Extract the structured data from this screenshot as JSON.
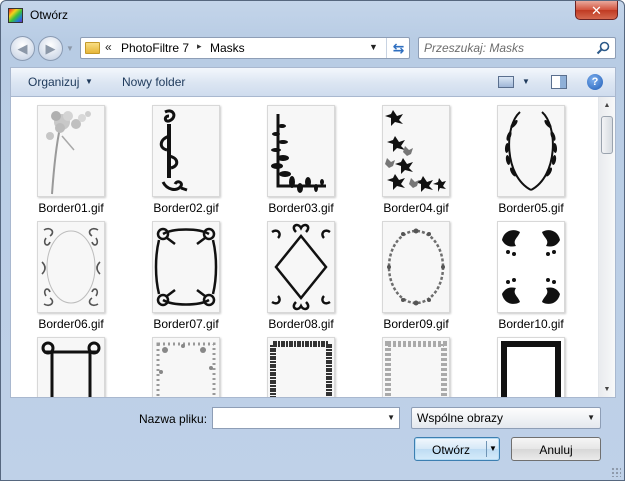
{
  "window": {
    "title": "Otwórz"
  },
  "nav": {
    "crumb_overflow": "«",
    "path": [
      "PhotoFiltre 7",
      "Masks"
    ],
    "path_separator": "▸"
  },
  "search": {
    "placeholder": "Przeszukaj: Masks"
  },
  "toolbar": {
    "organize_label": "Organizuj",
    "new_folder_label": "Nowy folder"
  },
  "files": [
    {
      "name": "Border01.gif",
      "icon": "mask-flower"
    },
    {
      "name": "Border02.gif",
      "icon": "mask-scroll-side"
    },
    {
      "name": "Border03.gif",
      "icon": "mask-leaf-corner"
    },
    {
      "name": "Border04.gif",
      "icon": "mask-maple-corner"
    },
    {
      "name": "Border05.gif",
      "icon": "mask-laurel"
    },
    {
      "name": "Border06.gif",
      "icon": "mask-ornate-oval"
    },
    {
      "name": "Border07.gif",
      "icon": "mask-knot-frame"
    },
    {
      "name": "Border08.gif",
      "icon": "mask-diamond-frame"
    },
    {
      "name": "Border09.gif",
      "icon": "mask-vine-oval"
    },
    {
      "name": "Border10.gif",
      "icon": "mask-leaf-corners"
    },
    {
      "name": "",
      "icon": "mask-post-curl"
    },
    {
      "name": "",
      "icon": "mask-floral-frame"
    },
    {
      "name": "",
      "icon": "mask-rough-frame"
    },
    {
      "name": "",
      "icon": "mask-soft-frame"
    },
    {
      "name": "",
      "icon": "mask-brush-frame"
    }
  ],
  "bottom": {
    "filename_label": "Nazwa pliku:",
    "filename_value": "",
    "filter_value": "Wspólne obrazy",
    "open_label": "Otwórz",
    "cancel_label": "Anuluj"
  }
}
